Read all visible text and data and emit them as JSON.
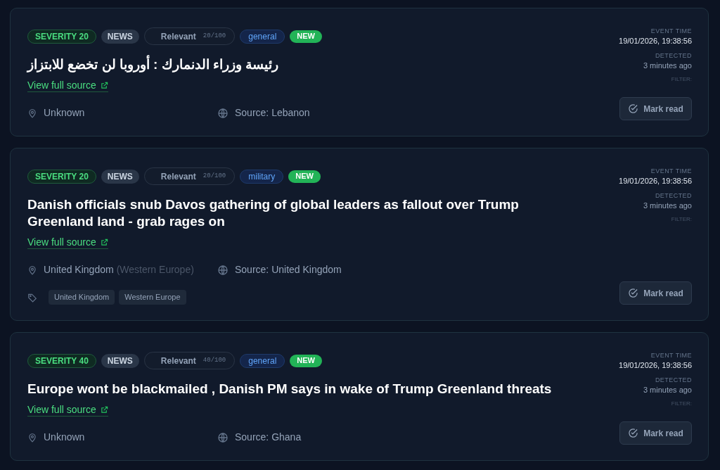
{
  "alerts": [
    {
      "severity": "SEVERITY 20",
      "type": "NEWS",
      "relevance_label": "Relevant",
      "relevance_score": "20/100",
      "category": "general",
      "new_badge": "NEW",
      "title": "رئيسة وزراء الدنمارك : أوروبا لن تخضع للابتزاز",
      "link": "View full source",
      "location": "Unknown",
      "source": "Source: Lebanon",
      "event_time_label": "EVENT TIME",
      "event_time": "19/01/2026, 19:38:56",
      "detected_label": "DETECTED",
      "detected": "3 minutes ago",
      "filter_label": "FILTER:",
      "action": "Mark read"
    },
    {
      "severity": "SEVERITY 20",
      "type": "NEWS",
      "relevance_label": "Relevant",
      "relevance_score": "20/100",
      "category": "military",
      "new_badge": "NEW",
      "title": "Danish officials snub Davos gathering of global leaders as fallout over Trump Greenland land - grab rages on",
      "link": "View full source",
      "location": "United Kingdom",
      "region": "(Western Europe)",
      "source": "Source: United Kingdom",
      "tags": [
        "United Kingdom",
        "Western Europe"
      ],
      "event_time_label": "EVENT TIME",
      "event_time": "19/01/2026, 19:38:56",
      "detected_label": "DETECTED",
      "detected": "3 minutes ago",
      "filter_label": "FILTER:",
      "action": "Mark read"
    },
    {
      "severity": "SEVERITY 40",
      "type": "NEWS",
      "relevance_label": "Relevant",
      "relevance_score": "40/100",
      "category": "general",
      "new_badge": "NEW",
      "title": "Europe wont be blackmailed , Danish PM says in wake of Trump Greenland threats",
      "link": "View full source",
      "location": "Unknown",
      "source": "Source: Ghana",
      "event_time_label": "EVENT TIME",
      "event_time": "19/01/2026, 19:38:56",
      "detected_label": "DETECTED",
      "detected": "3 minutes ago",
      "filter_label": "FILTER:",
      "action": "Mark read"
    }
  ]
}
